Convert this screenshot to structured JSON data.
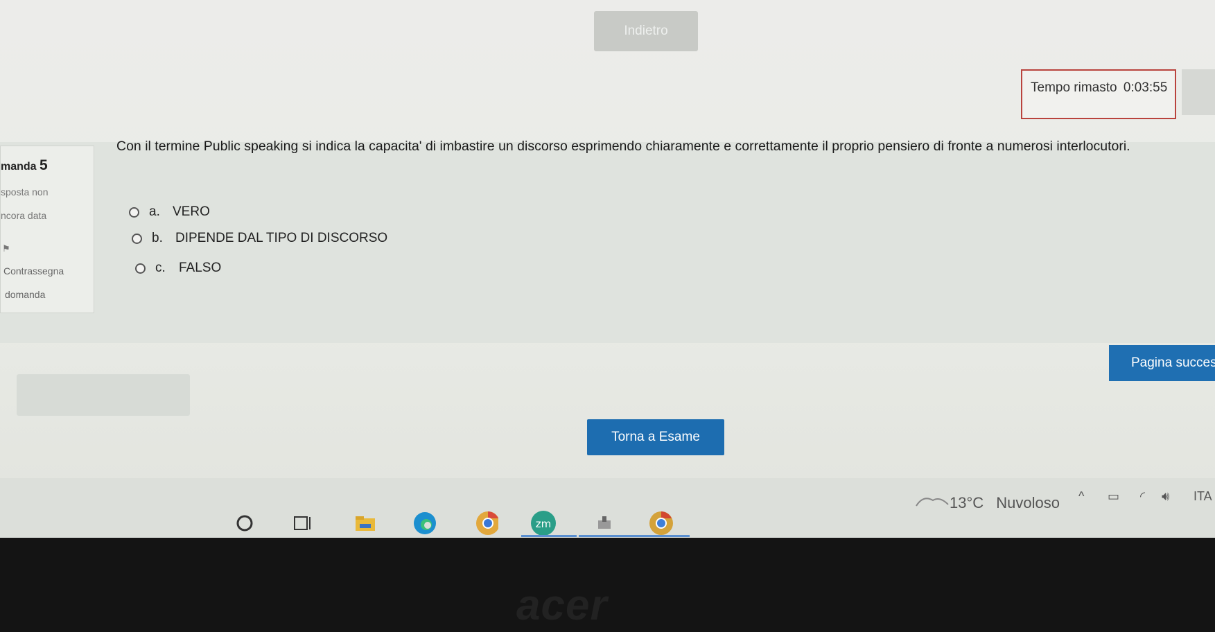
{
  "nav": {
    "back_label": "Indietro"
  },
  "timer": {
    "label": "Tempo rimasto",
    "value": "0:03:55"
  },
  "question_info": {
    "number_label": "manda",
    "number": "5",
    "status_line1": "sposta non",
    "status_line2": "ncora data",
    "flag_line1": "Contrassegna",
    "flag_line2": "domanda"
  },
  "question": {
    "text": "Con il termine Public speaking si indica la capacita' di imbastire un discorso esprimendo chiaramente e correttamente il proprio pensiero di fronte a numerosi interlocutori.",
    "options": [
      {
        "letter": "a.",
        "label": "VERO"
      },
      {
        "letter": "b.",
        "label": "DIPENDE DAL TIPO DI DISCORSO"
      },
      {
        "letter": "c.",
        "label": "FALSO"
      }
    ]
  },
  "buttons": {
    "next_page": "Pagina succes",
    "return_exam": "Torna a Esame"
  },
  "taskbar": {
    "weather_temp": "13°C",
    "weather_desc": "Nuvoloso",
    "language": "ITA",
    "pinned_apps": [
      "start",
      "task-view",
      "file-explorer",
      "edge",
      "chrome",
      "zoom",
      "app",
      "chrome-profile"
    ]
  },
  "device": {
    "brand": "acer"
  }
}
